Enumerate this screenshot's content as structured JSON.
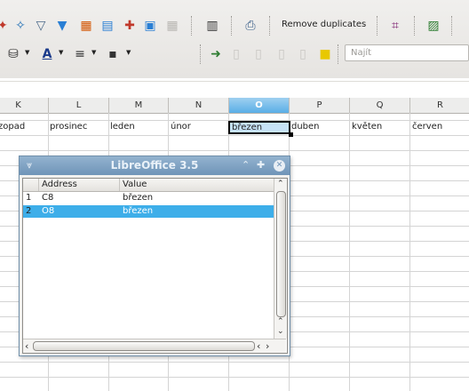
{
  "toolbar": {
    "remove_duplicates_label": "Remove duplicates",
    "find_placeholder": "Najít",
    "icons": [
      "wand-icon",
      "filter-icon",
      "autofilter-icon",
      "pivot-icon",
      "table-icon",
      "fix-icon",
      "window-icon",
      "grid-icon",
      "barcode-icon",
      "printer-user-icon",
      "crop-icon",
      "form-icon",
      "paint-bucket-icon",
      "font-color-icon",
      "line-style-icon",
      "border-icon",
      "export-icon",
      "blank-doc-icon",
      "note-icon"
    ]
  },
  "sheet": {
    "columns": [
      "K",
      "L",
      "M",
      "N",
      "O",
      "P",
      "Q",
      "R"
    ],
    "selected_column": "O",
    "row8": [
      "zopad",
      "prosinec",
      "leden",
      "únor",
      "březen",
      "duben",
      "květen",
      "červen"
    ],
    "colors": {
      "selection_header": "#5aaee6",
      "selected_cell": "#c6e2f6"
    }
  },
  "dialog": {
    "title": "LibreOffice 3.5",
    "columns": {
      "address": "Address",
      "value": "Value"
    },
    "rows": [
      {
        "n": "1",
        "address": "C8",
        "value": "březen"
      },
      {
        "n": "2",
        "address": "O8",
        "value": "březen",
        "selected": true
      }
    ],
    "colors": {
      "title_bar": "#6f94b8",
      "selected_row": "#3daee9"
    }
  }
}
